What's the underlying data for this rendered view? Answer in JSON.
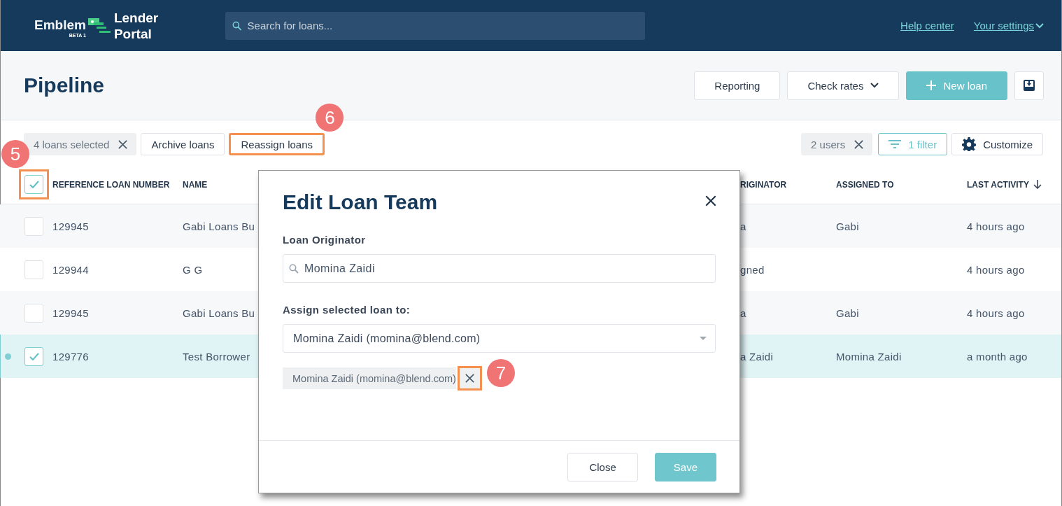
{
  "header": {
    "logo": {
      "brand": "Emblem",
      "badge": "BETA 1",
      "product_top": "Lender",
      "product_bottom": "Portal"
    },
    "search": {
      "placeholder": "Search for loans..."
    },
    "links": [
      {
        "label": "Help center",
        "kind": "link"
      },
      {
        "label": "Your settings",
        "kind": "menu"
      }
    ]
  },
  "page": {
    "title": "Pipeline",
    "actions": [
      {
        "label": "Reporting",
        "kind": "plain"
      },
      {
        "label": "Check rates",
        "kind": "dropdown"
      },
      {
        "label": "New loan",
        "kind": "primary"
      },
      {
        "kind": "download"
      }
    ]
  },
  "toolbar": {
    "selection_chip": {
      "label": "4 loans selected"
    },
    "buttons": [
      {
        "label": "Archive loans",
        "highlighted": false
      },
      {
        "label": "Reassign loans",
        "highlighted": true,
        "callout": "6"
      }
    ],
    "user_chip": {
      "label": "2 users"
    },
    "filter_button": {
      "label": "1 filter"
    },
    "customize_button": {
      "label": "Customize"
    }
  },
  "table": {
    "select_all": {
      "checked": true,
      "highlighted": true,
      "callout": "5"
    },
    "columns": [
      {
        "label": "REFERENCE LOAN NUMBER"
      },
      {
        "label": "NAME"
      },
      {
        "label": "RIGINATOR"
      },
      {
        "label": "ASSIGNED TO"
      },
      {
        "label": "LAST ACTIVITY",
        "sorted": true
      }
    ],
    "rows": [
      {
        "checked": false,
        "selected": false,
        "reference": "129945",
        "name": "Gabi Loans Bu",
        "originator": "a",
        "assigned_to": "Gabi",
        "last_activity": "4 hours ago"
      },
      {
        "checked": false,
        "selected": false,
        "reference": "129944",
        "name": "G G",
        "originator": "gned",
        "last_activity": "4 hours ago"
      },
      {
        "checked": false,
        "selected": false,
        "reference": "129945",
        "name": "Gabi Loans Bu",
        "originator": "a",
        "assigned_to": "Gabi",
        "last_activity": "4 hours ago"
      },
      {
        "checked": true,
        "selected": true,
        "reference": "129776",
        "name": "Test Borrower",
        "originator": "a Zaidi",
        "assigned_to": "Momina Zaidi",
        "last_activity": "a month ago"
      }
    ]
  },
  "dialog": {
    "title": "Edit Loan Team",
    "originator_label": "Loan Originator",
    "originator_search": {
      "value": "Momina Zaidi"
    },
    "assign_label": "Assign selected loan to:",
    "assign_select": {
      "value": "Momina Zaidi (momina@blend.com)"
    },
    "assigned_chips": [
      {
        "label": "Momina Zaidi (momina@blend.com)",
        "remove_highlighted": true,
        "callout": "7"
      }
    ],
    "buttons": [
      {
        "label": "Close",
        "kind": "secondary"
      },
      {
        "label": "Save",
        "kind": "primary"
      }
    ]
  }
}
